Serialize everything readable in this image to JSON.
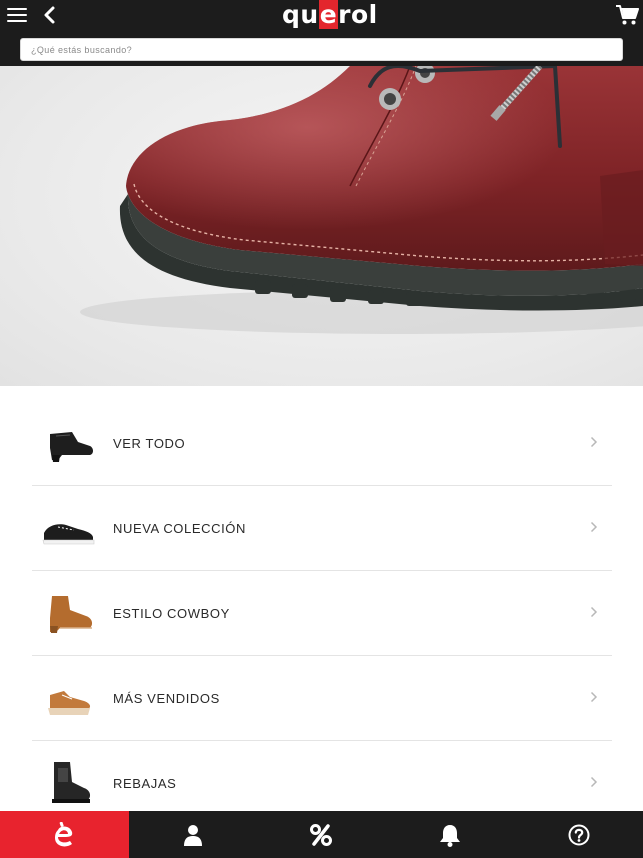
{
  "header": {
    "logo_text": "querol",
    "logo_parts": {
      "before": "qu",
      "highlight": "e",
      "after": "rol"
    },
    "brand_color": "#e3262d",
    "icons": [
      "hamburger-menu-icon",
      "back-arrow-icon",
      "shopping-cart-icon"
    ]
  },
  "search": {
    "placeholder": "¿Qué estás buscando?",
    "value": ""
  },
  "hero": {
    "image": "red-leather-boot-closeup"
  },
  "categories": [
    {
      "label": "VER TODO",
      "thumb": "black-heeled-bootie"
    },
    {
      "label": "NUEVA COLECCIÓN",
      "thumb": "black-canvas-sneaker"
    },
    {
      "label": "ESTILO COWBOY",
      "thumb": "tan-cowboy-bootie"
    },
    {
      "label": "MÁS VENDIDOS",
      "thumb": "tan-platform-sneaker"
    },
    {
      "label": "REBAJAS",
      "thumb": "black-chelsea-boot"
    }
  ],
  "tabbar": {
    "active_color": "#e8232e",
    "tabs": [
      {
        "icon": "brand-e-icon",
        "active": true
      },
      {
        "icon": "user-icon",
        "active": false
      },
      {
        "icon": "percent-icon",
        "active": false
      },
      {
        "icon": "bell-icon",
        "active": false
      },
      {
        "icon": "help-icon",
        "active": false
      }
    ]
  }
}
